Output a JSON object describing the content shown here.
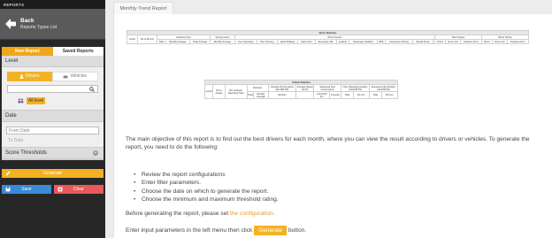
{
  "sidebar": {
    "header": "REPORTS",
    "back": {
      "title": "Back",
      "subtitle": "Reports Types List"
    },
    "tabs": {
      "new_report": "New Report",
      "saved_reports": "Saved Reports"
    },
    "level": {
      "title": "Level",
      "drivers": "Drivers",
      "vehicles": "Vehicles",
      "search_placeholder": "",
      "all_level": "All level"
    },
    "date": {
      "title": "Date",
      "from_placeholder": "From Date",
      "to_placeholder": "To Date"
    },
    "score_thresholds": {
      "title": "Score Thresholds"
    },
    "buttons": {
      "generate": "Generate",
      "save": "Save",
      "clear": "Clear"
    }
  },
  "main": {
    "tab_title": "Monthly Trend Report",
    "driver_table": {
      "title": "Driver Statistics",
      "month": "month",
      "nb_drivers": "Nb of Drivers",
      "groups": {
        "distance": "Distance (Km)",
        "driving_hours": "Driving Hours",
        "driver_scores": "Driver Scores",
        "best_scores": "Best Scores",
        "worst_scores": "Worst Scores"
      },
      "cols": {
        "total": "Total",
        "monthly_average": "Monthly Average",
        "daily_average": "Daily Average",
        "driving_hours_avg": "Monthly Average",
        "over_speeding": "Over Speeding",
        "over_revving": "Over Revving",
        "harsh_braking": "Harsh Braking",
        "harsh_acc": "Harsh ACC",
        "excessive_idle": "Excessive Idle",
        "seatbelt": "seatbelt",
        "passenger_seatbelt": "Passenger Seatbelt",
        "abs": "ABS",
        "continuous_driving": "Continuous Driving",
        "overall_score": "Overall Score",
        "best_driver": "Driver",
        "best_score": "Score (%)",
        "best_distance": "Distance (Km)",
        "worst_driver": "Driver",
        "worst_score": "Score (%)",
        "worst_distance": "Distance (Km)"
      }
    },
    "vehicle_table": {
      "title": "vehicle Statistics",
      "month": "month",
      "nb_assets": "Nb of Assets",
      "nb_assets_reporting": "Nb of Assets Reporting Total",
      "distance": "Distance",
      "avg_driving_hours": "Average Driving Hours (HH:MM:SS)",
      "avg_speed": "Average Speed (km/h)",
      "fuel": "Measured Fuel Consumption",
      "over_speeding_duration": "Over Speeding Duration (HH:MM:SS)",
      "excessive_idle_duration": "Excessive Idle Duration (HH:MM:SS)",
      "sub": {
        "total": "Total",
        "monthly_average": "Monthly Average",
        "monthly": "Monthly",
        "liters": "Liters/100 Km",
        "km_liter": "Km/Liter",
        "od_total": "Total",
        "od_per_km": "Per Km",
        "ei_total": "Total",
        "ei_per_km": "Per Km"
      }
    },
    "description": "The main objective of this report is to find out the best drivers for each month, where you can view the result according to drivers or vehicles. To generate the report, you need to do the following:",
    "steps": [
      "Review the report configurations",
      "Enter filter parameters.",
      "Choose the date on which to generate the report.",
      "Choose the minimum and maximum threshold rating."
    ],
    "before_text": "Before generating the report, please set",
    "before_link": "the configuration.",
    "enter_text_1": "Enter input parameters in the left menu then click",
    "enter_button": "Generate",
    "enter_text_2": "button."
  },
  "colors": {
    "accent": "#f4b223",
    "save": "#3a8ad6",
    "clear": "#e8595a",
    "sidebar": "#272727"
  }
}
